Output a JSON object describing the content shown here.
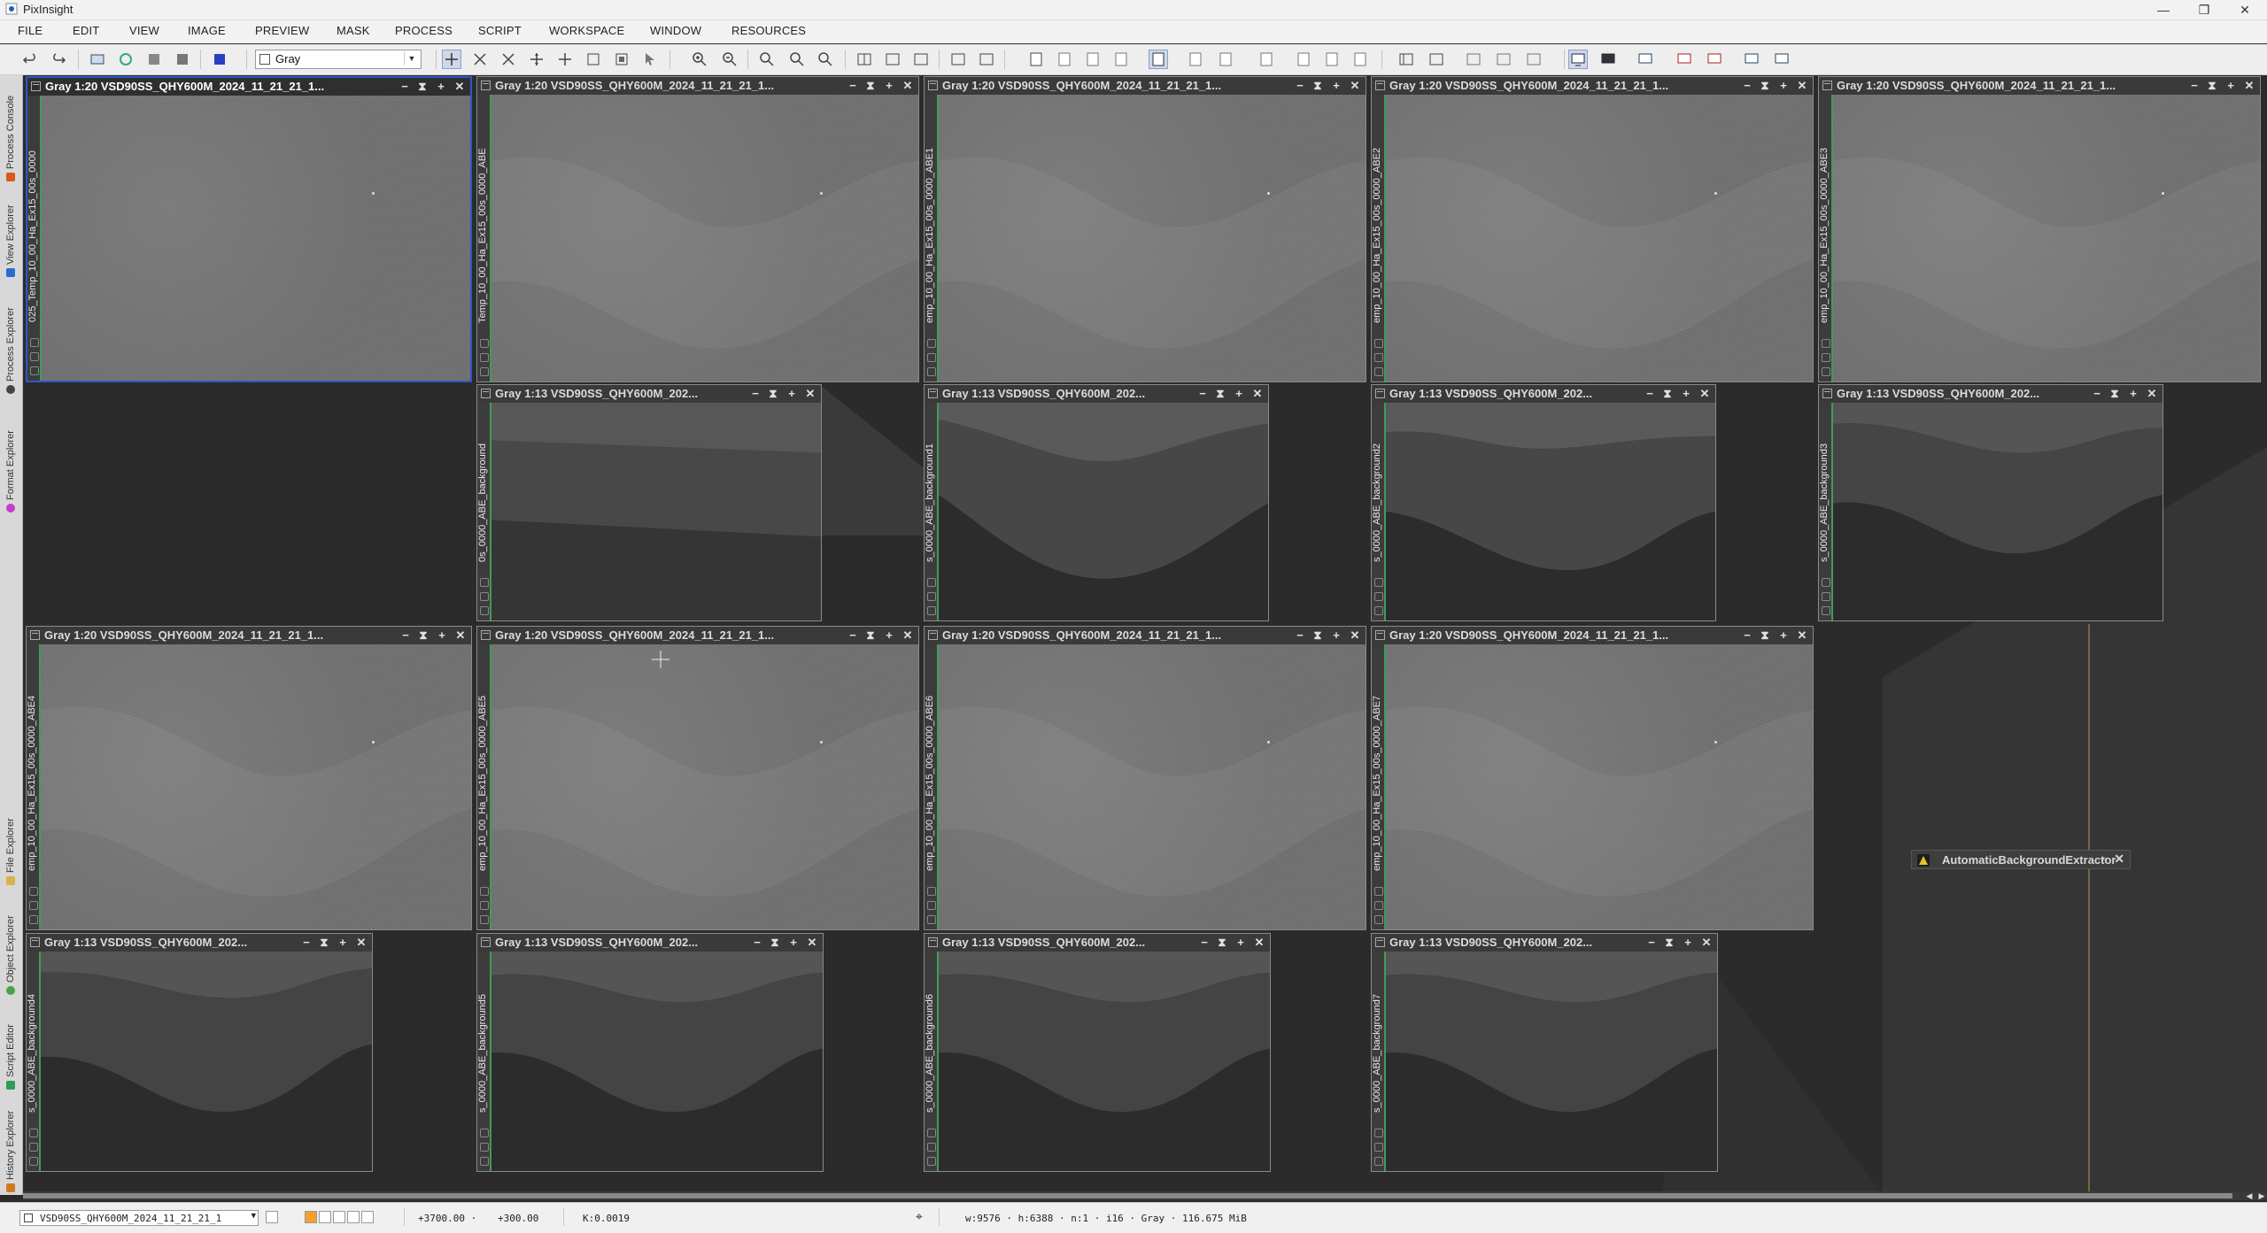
{
  "app": {
    "title": "PixInsight"
  },
  "menu": [
    "FILE",
    "EDIT",
    "VIEW",
    "IMAGE",
    "PREVIEW",
    "MASK",
    "PROCESS",
    "SCRIPT",
    "WORKSPACE",
    "WINDOW",
    "RESOURCES"
  ],
  "toolbar": {
    "color_space_value": "Gray"
  },
  "side_tabs": {
    "process_console": "Process Console",
    "view_explorer": "View Explorer",
    "process_explorer": "Process Explorer",
    "format_explorer": "Format Explorer",
    "file_explorer": "File Explorer",
    "object_explorer": "Object Explorer",
    "script_editor": "Script Editor",
    "history_explorer": "History Explorer"
  },
  "windows": [
    {
      "title": "Gray 1:20 VSD90SS_QHY600M_2024_11_21_21_1...",
      "side": "025_Temp_10_00_Ha_Ex15_00s_0000",
      "kind": "image",
      "active": true
    },
    {
      "title": "Gray 1:20 VSD90SS_QHY600M_2024_11_21_21_1...",
      "side": "Temp_10_00_Ha_Ex15_00s_0000_ABE",
      "kind": "image"
    },
    {
      "title": "Gray 1:20 VSD90SS_QHY600M_2024_11_21_21_1...",
      "side": "emp_10_00_Ha_Ex15_00s_0000_ABE1",
      "kind": "image"
    },
    {
      "title": "Gray 1:20 VSD90SS_QHY600M_2024_11_21_21_1...",
      "side": "emp_10_00_Ha_Ex15_00s_0000_ABE2",
      "kind": "image"
    },
    {
      "title": "Gray 1:20 VSD90SS_QHY600M_2024_11_21_21_1...",
      "side": "emp_10_00_Ha_Ex15_00s_0000_ABE3",
      "kind": "image"
    },
    {
      "title": "Gray 1:13 VSD90SS_QHY600M_202...",
      "side": "0s_0000_ABE_background",
      "kind": "bg0"
    },
    {
      "title": "Gray 1:13 VSD90SS_QHY600M_202...",
      "side": "s_0000_ABE_background1",
      "kind": "bg1"
    },
    {
      "title": "Gray 1:13 VSD90SS_QHY600M_202...",
      "side": "s_0000_ABE_background2",
      "kind": "bg2"
    },
    {
      "title": "Gray 1:13 VSD90SS_QHY600M_202...",
      "side": "s_0000_ABE_background3",
      "kind": "bg3"
    },
    {
      "title": "Gray 1:20 VSD90SS_QHY600M_2024_11_21_21_1...",
      "side": "emp_10_00_Ha_Ex15_00s_0000_ABE4",
      "kind": "image"
    },
    {
      "title": "Gray 1:20 VSD90SS_QHY600M_2024_11_21_21_1...",
      "side": "emp_10_00_Ha_Ex15_00s_0000_ABE5",
      "kind": "image"
    },
    {
      "title": "Gray 1:20 VSD90SS_QHY600M_2024_11_21_21_1...",
      "side": "emp_10_00_Ha_Ex15_00s_0000_ABE6",
      "kind": "image"
    },
    {
      "title": "Gray 1:20 VSD90SS_QHY600M_2024_11_21_21_1...",
      "side": "emp_10_00_Ha_Ex15_00s_0000_ABE7",
      "kind": "image"
    },
    {
      "title": "Gray 1:13 VSD90SS_QHY600M_202...",
      "side": "s_0000_ABE_background4",
      "kind": "bg4"
    },
    {
      "title": "Gray 1:13 VSD90SS_QHY600M_202...",
      "side": "s_0000_ABE_background5",
      "kind": "bg5"
    },
    {
      "title": "Gray 1:13 VSD90SS_QHY600M_202...",
      "side": "s_0000_ABE_background6",
      "kind": "bg6"
    },
    {
      "title": "Gray 1:13 VSD90SS_QHY600M_202...",
      "side": "s_0000_ABE_background7",
      "kind": "bg7"
    }
  ],
  "process_icon": {
    "label": "AutomaticBackgroundExtractor"
  },
  "statusbar": {
    "view_name": "VSD90SS_QHY600M_2024_11_21_21_1",
    "x_coord": "+3700.00 ·",
    "y_coord": "+300.00",
    "k_value": "K:0.0019",
    "image_info": "w:9576 · h:6388 · n:1 · i16 · Gray · 116.675 MiB"
  },
  "colors": {
    "accent": "#2f56c8",
    "workspace": "#2b2b2b",
    "green_strip": "#3e9e55"
  }
}
